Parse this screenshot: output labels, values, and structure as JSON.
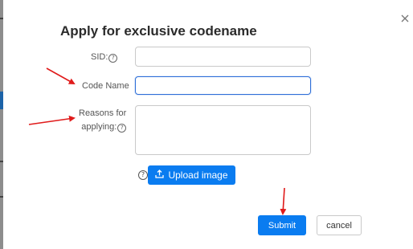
{
  "dialog": {
    "title": "Apply for exclusive codename",
    "close_icon": "close-icon"
  },
  "form": {
    "sid_label": "SID:",
    "sid_value": "",
    "code_name_label": "Code Name",
    "code_name_value": "",
    "reasons_label_line1": "Reasons for",
    "reasons_label_line2": "applying:",
    "reasons_value": "",
    "help_glyph": "?",
    "help_icon": "question-circle-icon"
  },
  "upload": {
    "label": "Upload image",
    "icon": "upload-icon"
  },
  "actions": {
    "submit_label": "Submit",
    "cancel_label": "cancel"
  },
  "annotations": {
    "arrow_color": "#e01b1b"
  },
  "colors": {
    "primary": "#0a7cf0",
    "focus_border": "#2f6fd8"
  }
}
